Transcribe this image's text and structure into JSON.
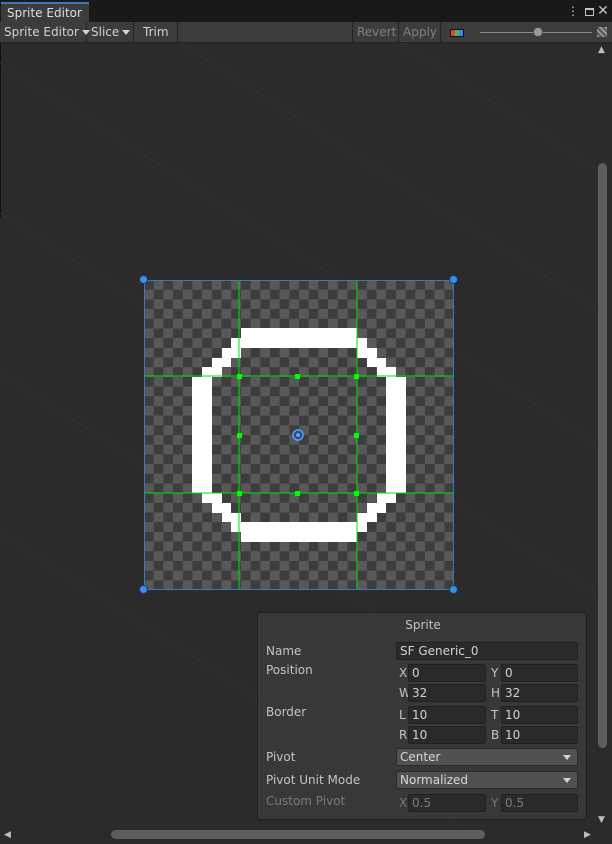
{
  "window": {
    "tab_title": "Sprite Editor"
  },
  "toolbar": {
    "sprite_editor_menu": "Sprite Editor",
    "slice": "Slice",
    "trim": "Trim",
    "revert": "Revert",
    "apply": "Apply",
    "zoom_level": 0.55
  },
  "icons": [
    "kebab-menu-icon",
    "maximize-icon",
    "close-icon",
    "color-channel-icon",
    "mip-level-icon",
    "pivot-icon"
  ],
  "colors": {
    "accent": "#3a79bb",
    "handle": "#3a8ee6",
    "border_guides": "#00e000",
    "pivot": "#5aa0ff"
  },
  "sprite_panel": {
    "title": "Sprite",
    "name_label": "Name",
    "name_value": "SF Generic_0",
    "position_label": "Position",
    "x_axis": "X",
    "x_value": "0",
    "y_axis": "Y",
    "y_value": "0",
    "w_axis": "W",
    "w_value": "32",
    "h_axis": "H",
    "h_value": "32",
    "border_label": "Border",
    "l_axis": "L",
    "l_value": "10",
    "t_axis": "T",
    "t_value": "10",
    "r_axis": "R",
    "r_value": "10",
    "b_axis": "B",
    "b_value": "10",
    "pivot_label": "Pivot",
    "pivot_value": "Center",
    "pivot_unit_label": "Pivot Unit Mode",
    "pivot_unit_value": "Normalized",
    "custom_pivot_label": "Custom Pivot",
    "cp_x_axis": "X",
    "cp_x_value": "0.5",
    "cp_y_axis": "Y",
    "cp_y_value": "0.5"
  }
}
